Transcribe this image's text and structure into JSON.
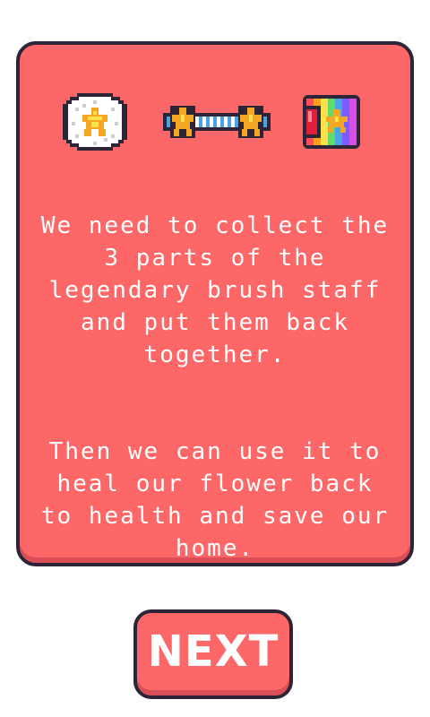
{
  "dialog": {
    "items": [
      {
        "icon": "daisy-flower-icon"
      },
      {
        "icon": "staff-rod-icon"
      },
      {
        "icon": "rainbow-jewel-icon"
      }
    ],
    "paragraphs": [
      "We need to collect the\n3 parts of the\nlegendary brush staff\nand put them back\ntogether.",
      "Then we can use it to\nheal our flower back\nto health and save our\nhome."
    ]
  },
  "next_button": {
    "label": "NEXT"
  },
  "colors": {
    "panel": "#fe6767",
    "outline": "#2d2438",
    "text": "#ffffff"
  }
}
